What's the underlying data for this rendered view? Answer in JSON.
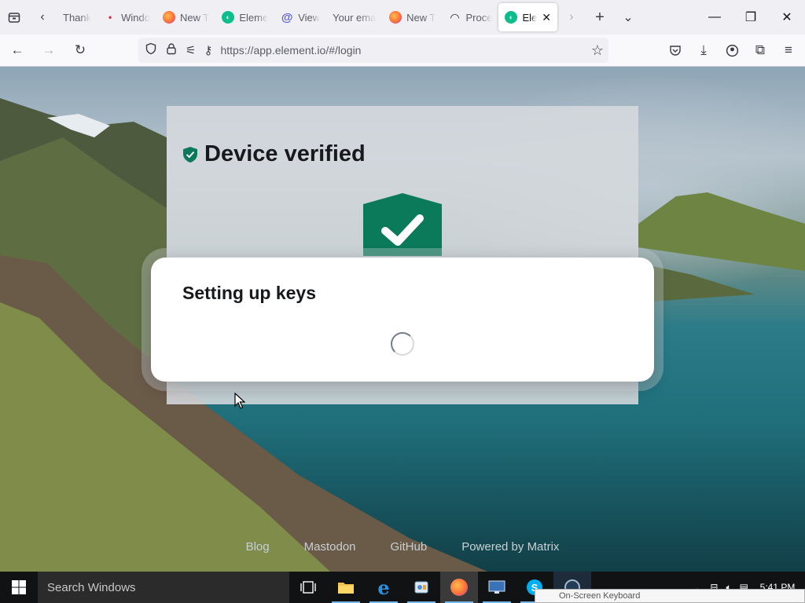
{
  "browser": {
    "tabs": [
      {
        "title": "Thank",
        "favicon_color": "#8a8a8a",
        "active": false
      },
      {
        "title": "Windo",
        "favicon_color": "#d92b3a",
        "active": false
      },
      {
        "title": "New T",
        "favicon_color": "#ff7139",
        "active": false
      },
      {
        "title": "Eleme",
        "favicon_color": "#0dbd8b",
        "active": false
      },
      {
        "title": "View",
        "favicon_color": "#5b5bd6",
        "active": false
      },
      {
        "title": "Your emai",
        "favicon_color": "",
        "active": false
      },
      {
        "title": "New T",
        "favicon_color": "#ff7139",
        "active": false
      },
      {
        "title": "Proce",
        "favicon_color": "#15141a",
        "active": false
      },
      {
        "title": "Ele",
        "favicon_color": "#0dbd8b",
        "active": true
      }
    ],
    "url": "https://app.element.io/#/login",
    "accent": "#0a84ff"
  },
  "verified_card": {
    "title": "Device verified",
    "accent": "#0b7a5b"
  },
  "dialog": {
    "title": "Setting up keys"
  },
  "footer": {
    "links": [
      "Blog",
      "Mastodon",
      "GitHub",
      "Powered by Matrix"
    ]
  },
  "taskbar": {
    "search_placeholder": "Search Windows",
    "clock": "5:41 PM",
    "osk_label": "On-Screen Keyboard"
  }
}
